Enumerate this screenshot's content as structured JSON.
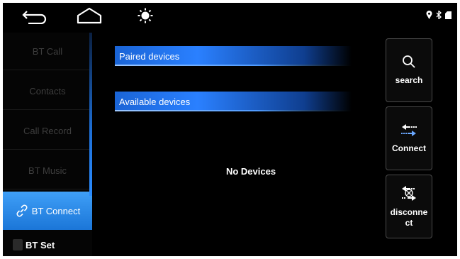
{
  "statusbar": {
    "back_icon": "back-arrow-icon",
    "home_icon": "home-icon",
    "brightness_icon": "brightness-icon",
    "right_icons": [
      "location-icon",
      "bluetooth-icon",
      "sd-card-icon"
    ]
  },
  "sidebar": {
    "items": [
      {
        "label": "BT Call"
      },
      {
        "label": "Contacts"
      },
      {
        "label": "Call Record"
      },
      {
        "label": "BT Music"
      },
      {
        "label": "BT Connect"
      },
      {
        "label": "BT Set"
      }
    ],
    "active_index": 4
  },
  "main": {
    "paired_title": "Paired devices",
    "available_title": "Available devices",
    "empty_text": "No Devices"
  },
  "actions": {
    "search_label": "search",
    "connect_label": "Connect",
    "disconnect_line1": "disconne",
    "disconnect_line2": "ct"
  },
  "colors": {
    "accent": "#2a80ff",
    "background": "#000000"
  }
}
